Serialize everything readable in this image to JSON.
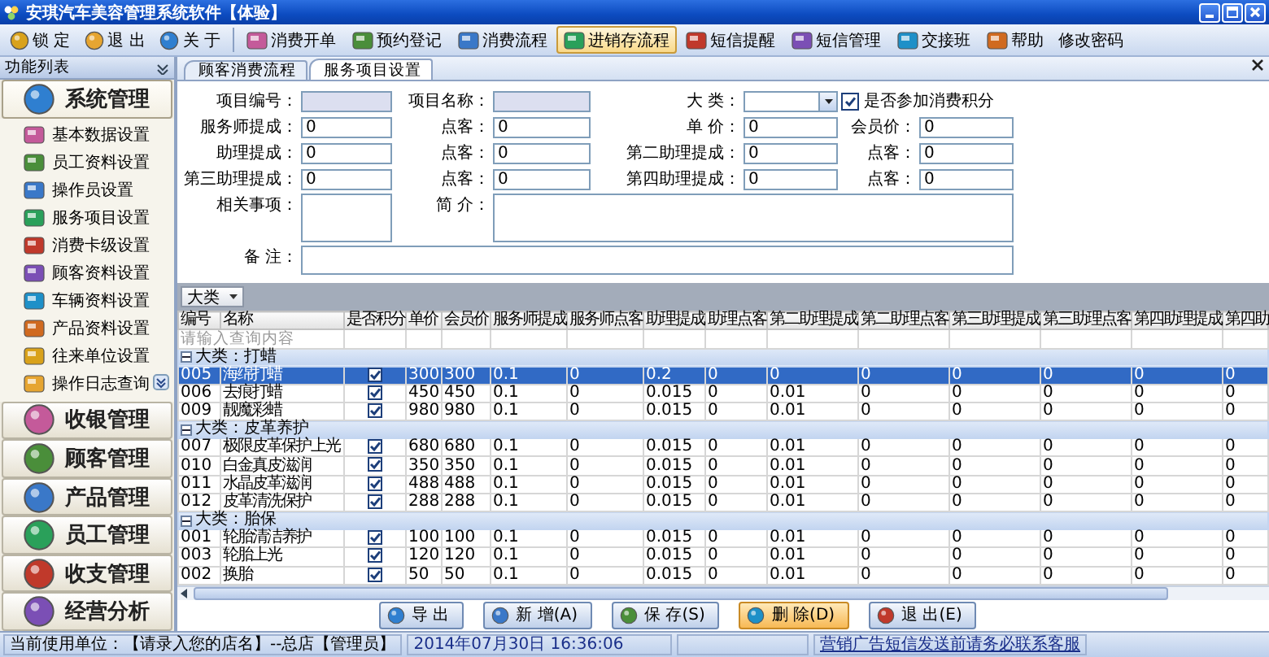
{
  "window": {
    "title": "安琪汽车美容管理系统软件【体验】"
  },
  "toolbar": {
    "quick_actions": [
      {
        "label": "锁 定",
        "selected": false
      },
      {
        "label": "退 出",
        "selected": false
      },
      {
        "label": "关 于",
        "selected": false
      }
    ],
    "modules": [
      {
        "label": "消费开单",
        "kind": "icon",
        "selected": false
      },
      {
        "label": "预约登记",
        "kind": "icon",
        "selected": false
      },
      {
        "label": "消费流程",
        "kind": "icon",
        "selected": false
      },
      {
        "label": "进销存流程",
        "kind": "icon",
        "selected": true
      },
      {
        "label": "短信提醒",
        "kind": "icon",
        "selected": false
      },
      {
        "label": "短信管理",
        "kind": "icon",
        "selected": false
      },
      {
        "label": "交接班",
        "kind": "icon",
        "selected": false
      },
      {
        "label": "帮助",
        "kind": "icon",
        "selected": false
      },
      {
        "label": "修改密码",
        "kind": "plain",
        "selected": false
      }
    ]
  },
  "sidebar": {
    "title": "功能列表",
    "groups": [
      {
        "label": "系统管理",
        "expanded": true,
        "items": [
          "基本数据设置",
          "员工资料设置",
          "操作员设置",
          "服务项目设置",
          "消费卡级设置",
          "顾客资料设置",
          "车辆资料设置",
          "产品资料设置",
          "往来单位设置",
          "操作日志查询"
        ]
      },
      {
        "label": "收银管理",
        "expanded": false
      },
      {
        "label": "顾客管理",
        "expanded": false
      },
      {
        "label": "产品管理",
        "expanded": false
      },
      {
        "label": "员工管理",
        "expanded": false
      },
      {
        "label": "收支管理",
        "expanded": false
      },
      {
        "label": "经营分析",
        "expanded": false
      }
    ]
  },
  "tabs": [
    {
      "label": "顾客消费流程",
      "selected": false
    },
    {
      "label": "服务项目设置",
      "selected": true
    }
  ],
  "form": {
    "rows": [
      [
        {
          "kind": "readonly",
          "label": "项目编号："
        },
        {
          "kind": "readonly",
          "label": "项目名称："
        },
        {
          "kind": "combo",
          "label": "大 类："
        },
        {
          "kind": "check",
          "label": "是否参加消费积分",
          "checked": true
        }
      ],
      [
        {
          "kind": "text",
          "label": "服务师提成：",
          "value": "0"
        },
        {
          "kind": "text",
          "label": "点客：",
          "value": "0"
        },
        {
          "kind": "text",
          "label": "单 价：",
          "value": "0"
        },
        {
          "kind": "text",
          "label": "会员价：",
          "value": "0"
        }
      ],
      [
        {
          "kind": "text",
          "label": "助理提成：",
          "value": "0"
        },
        {
          "kind": "text",
          "label": "点客：",
          "value": "0"
        },
        {
          "kind": "text",
          "label": "第二助理提成：",
          "value": "0"
        },
        {
          "kind": "text",
          "label": "点客：",
          "value": "0"
        }
      ],
      [
        {
          "kind": "text",
          "label": "第三助理提成：",
          "value": "0"
        },
        {
          "kind": "text",
          "label": "点客：",
          "value": "0"
        },
        {
          "kind": "text",
          "label": "第四助理提成：",
          "value": "0"
        },
        {
          "kind": "text",
          "label": "点客：",
          "value": "0"
        }
      ],
      [
        {
          "kind": "memo",
          "label": "相关事项："
        },
        {
          "kind": "memo",
          "label": "简 介："
        }
      ],
      [
        {
          "kind": "memo",
          "label": "备 注："
        }
      ]
    ]
  },
  "table": {
    "group_by": "大类",
    "columns": [
      "编号",
      "名称",
      "是否积分",
      "单价",
      "会员价",
      "服务师提成",
      "服务师点客",
      "助理提成",
      "助理点客",
      "第二助理提成",
      "第二助理点客",
      "第三助理提成",
      "第三助理点客",
      "第四助理提成",
      "第四助"
    ],
    "filter_placeholder": "请输入查询内容",
    "groups": [
      {
        "label": "大类：打蜡",
        "expanded": true,
        "rows": [
          {
            "selected": true,
            "points": true,
            "cells": [
              "005",
              "海绵打蜡",
              "300",
              "300",
              "0.1",
              "0",
              "0.2",
              "0",
              "0",
              "0",
              "0",
              "0",
              "0",
              "0"
            ]
          },
          {
            "selected": false,
            "points": true,
            "cells": [
              "006",
              "去痕打蜡",
              "450",
              "450",
              "0.1",
              "0",
              "0.015",
              "0",
              "0.01",
              "0",
              "0",
              "0",
              "0",
              "0"
            ]
          },
          {
            "selected": false,
            "points": true,
            "cells": [
              "009",
              "靓魔彩蜡",
              "980",
              "980",
              "0.1",
              "0",
              "0.015",
              "0",
              "0.01",
              "0",
              "0",
              "0",
              "0",
              "0"
            ]
          }
        ]
      },
      {
        "label": "大类：皮革养护",
        "expanded": true,
        "rows": [
          {
            "selected": false,
            "points": true,
            "cells": [
              "007",
              "极限皮革保护上光",
              "680",
              "680",
              "0.1",
              "0",
              "0.015",
              "0",
              "0.01",
              "0",
              "0",
              "0",
              "0",
              "0"
            ]
          },
          {
            "selected": false,
            "points": true,
            "cells": [
              "010",
              "白金真皮滋润",
              "350",
              "350",
              "0.1",
              "0",
              "0.015",
              "0",
              "0.01",
              "0",
              "0",
              "0",
              "0",
              "0"
            ]
          },
          {
            "selected": false,
            "points": true,
            "cells": [
              "011",
              "水晶皮革滋润",
              "488",
              "488",
              "0.1",
              "0",
              "0.015",
              "0",
              "0.01",
              "0",
              "0",
              "0",
              "0",
              "0"
            ]
          },
          {
            "selected": false,
            "points": true,
            "cells": [
              "012",
              "皮革清洗保护",
              "288",
              "288",
              "0.1",
              "0",
              "0.015",
              "0",
              "0.01",
              "0",
              "0",
              "0",
              "0",
              "0"
            ]
          }
        ]
      },
      {
        "label": "大类：胎保",
        "expanded": true,
        "rows": [
          {
            "selected": false,
            "points": true,
            "cells": [
              "001",
              "轮胎清洁养护",
              "100",
              "100",
              "0.1",
              "0",
              "0.015",
              "0",
              "0.01",
              "0",
              "0",
              "0",
              "0",
              "0"
            ]
          },
          {
            "selected": false,
            "points": true,
            "cells": [
              "003",
              "轮胎上光",
              "120",
              "120",
              "0.1",
              "0",
              "0.015",
              "0",
              "0.01",
              "0",
              "0",
              "0",
              "0",
              "0"
            ]
          },
          {
            "selected": false,
            "points": true,
            "cells": [
              "002",
              "换胎",
              "50",
              "50",
              "0.1",
              "0",
              "0.015",
              "0",
              "0.01",
              "0",
              "0",
              "0",
              "0",
              "0"
            ]
          }
        ]
      }
    ]
  },
  "actions": [
    {
      "label": "导 出",
      "selected": false
    },
    {
      "label": "新 增(A)",
      "selected": false
    },
    {
      "label": "保 存(S)",
      "selected": false
    },
    {
      "label": "删 除(D)",
      "selected": true
    },
    {
      "label": "退 出(E)",
      "selected": false
    }
  ],
  "status_bar": [
    "当前使用单位：【请录入您的店名】--总店【管理员】",
    "2014年07月30日  16:36:06",
    "营销广告短信发送前请务必联系客服"
  ]
}
